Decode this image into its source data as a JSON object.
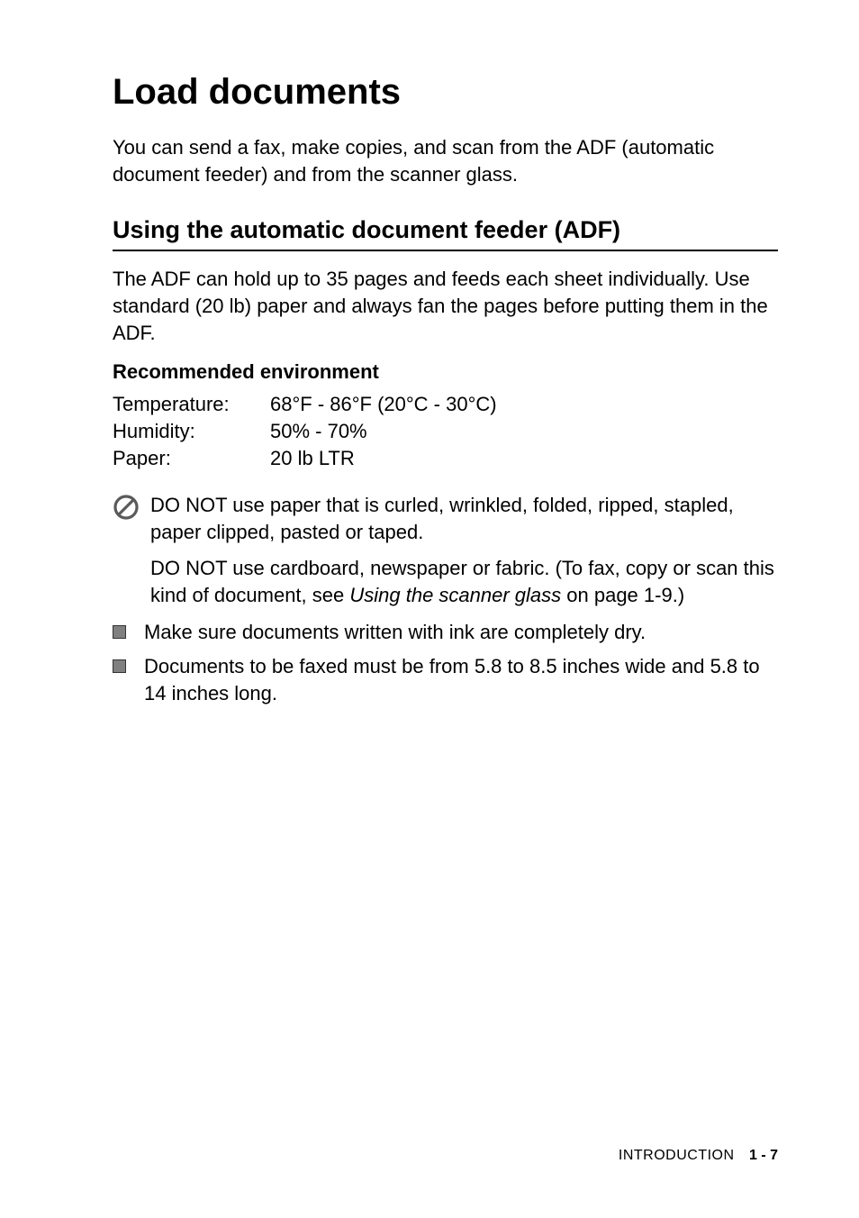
{
  "title": "Load documents",
  "intro": "You can send a fax, make copies, and scan from the ADF (automatic document feeder) and from the scanner glass.",
  "subtitle": "Using the automatic document feeder (ADF)",
  "section_text": "The ADF can hold up to 35 pages and feeds each sheet individually. Use standard (20 lb) paper and always fan the pages before putting them in the ADF.",
  "env_heading": "Recommended environment",
  "env": {
    "temperature_label": "Temperature:",
    "temperature_value": "68°F - 86°F (20°C - 30°C)",
    "humidity_label": "Humidity:",
    "humidity_value": "50% - 70%",
    "paper_label": "Paper:",
    "paper_value": "20 lb LTR"
  },
  "warning": {
    "p1": "DO NOT use paper that is curled, wrinkled, folded, ripped, stapled, paper clipped, pasted or taped.",
    "p2_a": "DO NOT use cardboard, newspaper or fabric. (To fax, copy or scan this kind of document, see ",
    "p2_link": "Using the scanner glass",
    "p2_b": " on page 1-9.)"
  },
  "bullets": [
    "Make sure documents written with ink are completely dry.",
    "Documents to be faxed must be from 5.8 to 8.5 inches wide and 5.8 to 14 inches long."
  ],
  "footer": {
    "section": "INTRODUCTION",
    "page": "1 - 7"
  }
}
